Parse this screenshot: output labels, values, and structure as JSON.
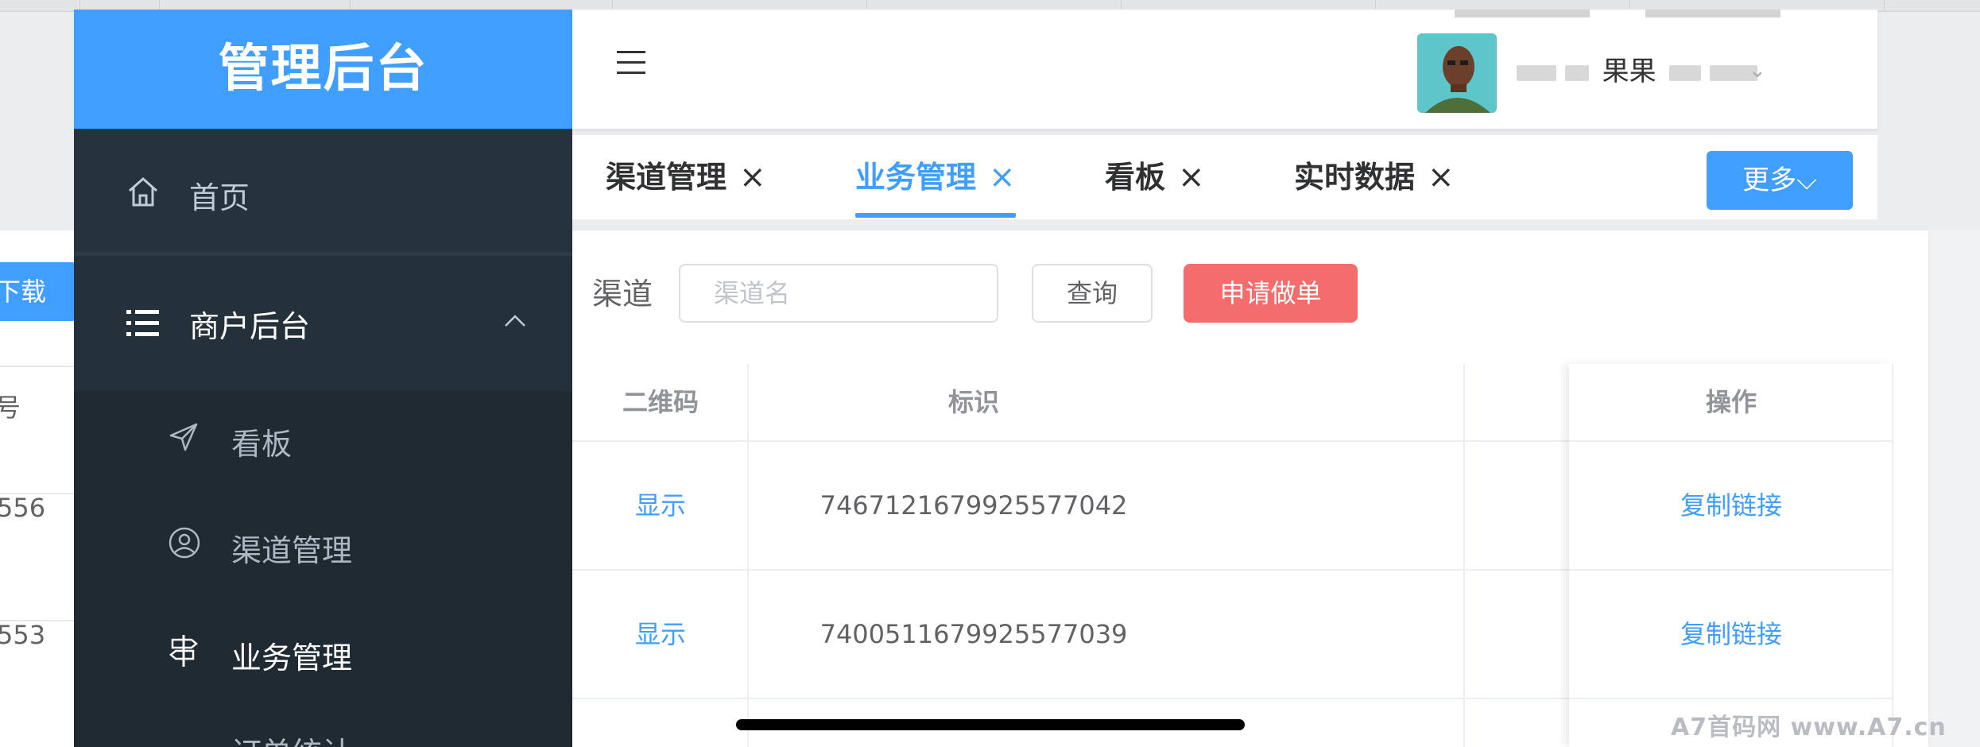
{
  "brand": {
    "title": "管理后台"
  },
  "sidebar": {
    "home_label": "首页",
    "merchant_label": "商户后台",
    "items": [
      {
        "label": "看板"
      },
      {
        "label": "渠道管理"
      },
      {
        "label": "业务管理"
      },
      {
        "label": "订单统计"
      }
    ]
  },
  "header": {
    "username": "果果",
    "caret": "⌄"
  },
  "tabs": [
    {
      "label": "渠道管理",
      "close": "×"
    },
    {
      "label": "业务管理",
      "close": "×"
    },
    {
      "label": "看板",
      "close": "×"
    },
    {
      "label": "实时数据",
      "close": "×"
    }
  ],
  "more_button": "更多⌵",
  "filter": {
    "label": "渠道",
    "input_placeholder": "渠道名",
    "query_button": "查询",
    "apply_button": "申请做单"
  },
  "table": {
    "headers": {
      "qrcode": "二维码",
      "id": "标识",
      "action": "操作"
    },
    "rows": [
      {
        "qrcode": "显示",
        "id": "7467121679925577042",
        "action": "复制链接"
      },
      {
        "qrcode": "显示",
        "id": "7400511679925577039",
        "action": "复制链接"
      }
    ]
  },
  "background_page": {
    "download": "下载",
    "header_fragment": "号",
    "row1_fragment": "556",
    "row2_fragment": "553"
  },
  "watermark": "A7首码网    www.A7.cn",
  "colors": {
    "primary": "#409eff",
    "danger": "#f56c6c",
    "sidebar": "#2e3a45"
  }
}
